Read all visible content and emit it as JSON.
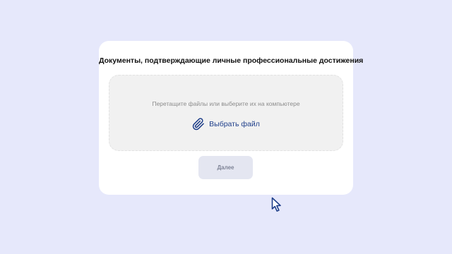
{
  "upload_card": {
    "title": "Документы, подтверждающие личные профессиональные достижения",
    "dropzone": {
      "hint": "Перетащите файлы или выберите их на компьютере",
      "choose_label": "Выбрать файл",
      "icon": "paperclip-icon"
    },
    "next_label": "Далее"
  },
  "cursor": {
    "icon": "mouse-pointer-icon"
  },
  "colors": {
    "background": "#e6e8fb",
    "card": "#ffffff",
    "dropzone": "#f1f1f1",
    "link": "#1f3f8a",
    "button_bg": "#e4e6f1",
    "button_text": "#7f8497"
  }
}
